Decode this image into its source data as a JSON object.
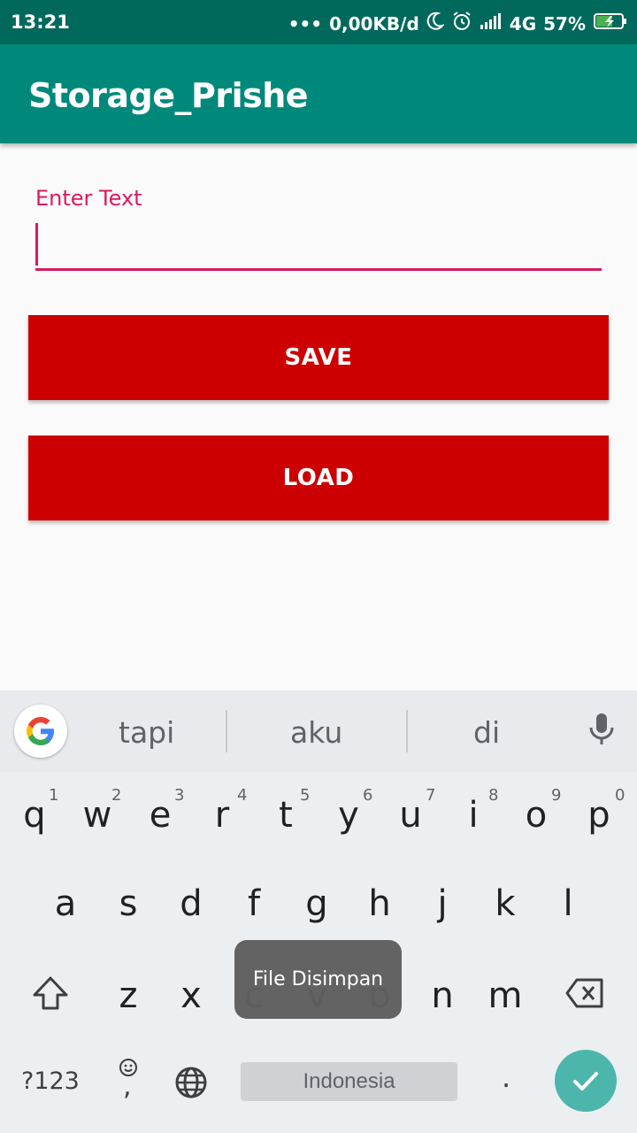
{
  "status_bar": {
    "time": "13:21",
    "dots": "•••",
    "data_rate": "0,00KB/d",
    "network": "4G",
    "battery": "57%"
  },
  "app_bar": {
    "title": "Storage_Prishe"
  },
  "form": {
    "label": "Enter Text",
    "value": "",
    "save_label": "SAVE",
    "load_label": "LOAD"
  },
  "keyboard": {
    "suggestions": [
      "tapi",
      "aku",
      "di"
    ],
    "row1": [
      {
        "key": "q",
        "hint": "1"
      },
      {
        "key": "w",
        "hint": "2"
      },
      {
        "key": "e",
        "hint": "3"
      },
      {
        "key": "r",
        "hint": "4"
      },
      {
        "key": "t",
        "hint": "5"
      },
      {
        "key": "y",
        "hint": "6"
      },
      {
        "key": "u",
        "hint": "7"
      },
      {
        "key": "i",
        "hint": "8"
      },
      {
        "key": "o",
        "hint": "9"
      },
      {
        "key": "p",
        "hint": "0"
      }
    ],
    "row2": [
      "a",
      "s",
      "d",
      "f",
      "g",
      "h",
      "j",
      "k",
      "l"
    ],
    "row3": [
      "z",
      "x",
      "c",
      "v",
      "b",
      "n",
      "m"
    ],
    "symbols_label": "?123",
    "emoji_comma": ",",
    "space_label": "Indonesia",
    "period": "."
  },
  "toast": {
    "text": "File Disimpan"
  },
  "colors": {
    "primary": "#00897b",
    "primary_dark": "#00695c",
    "accent": "#d81b60",
    "button": "#cc0000",
    "enter_key": "#4db6ac"
  }
}
